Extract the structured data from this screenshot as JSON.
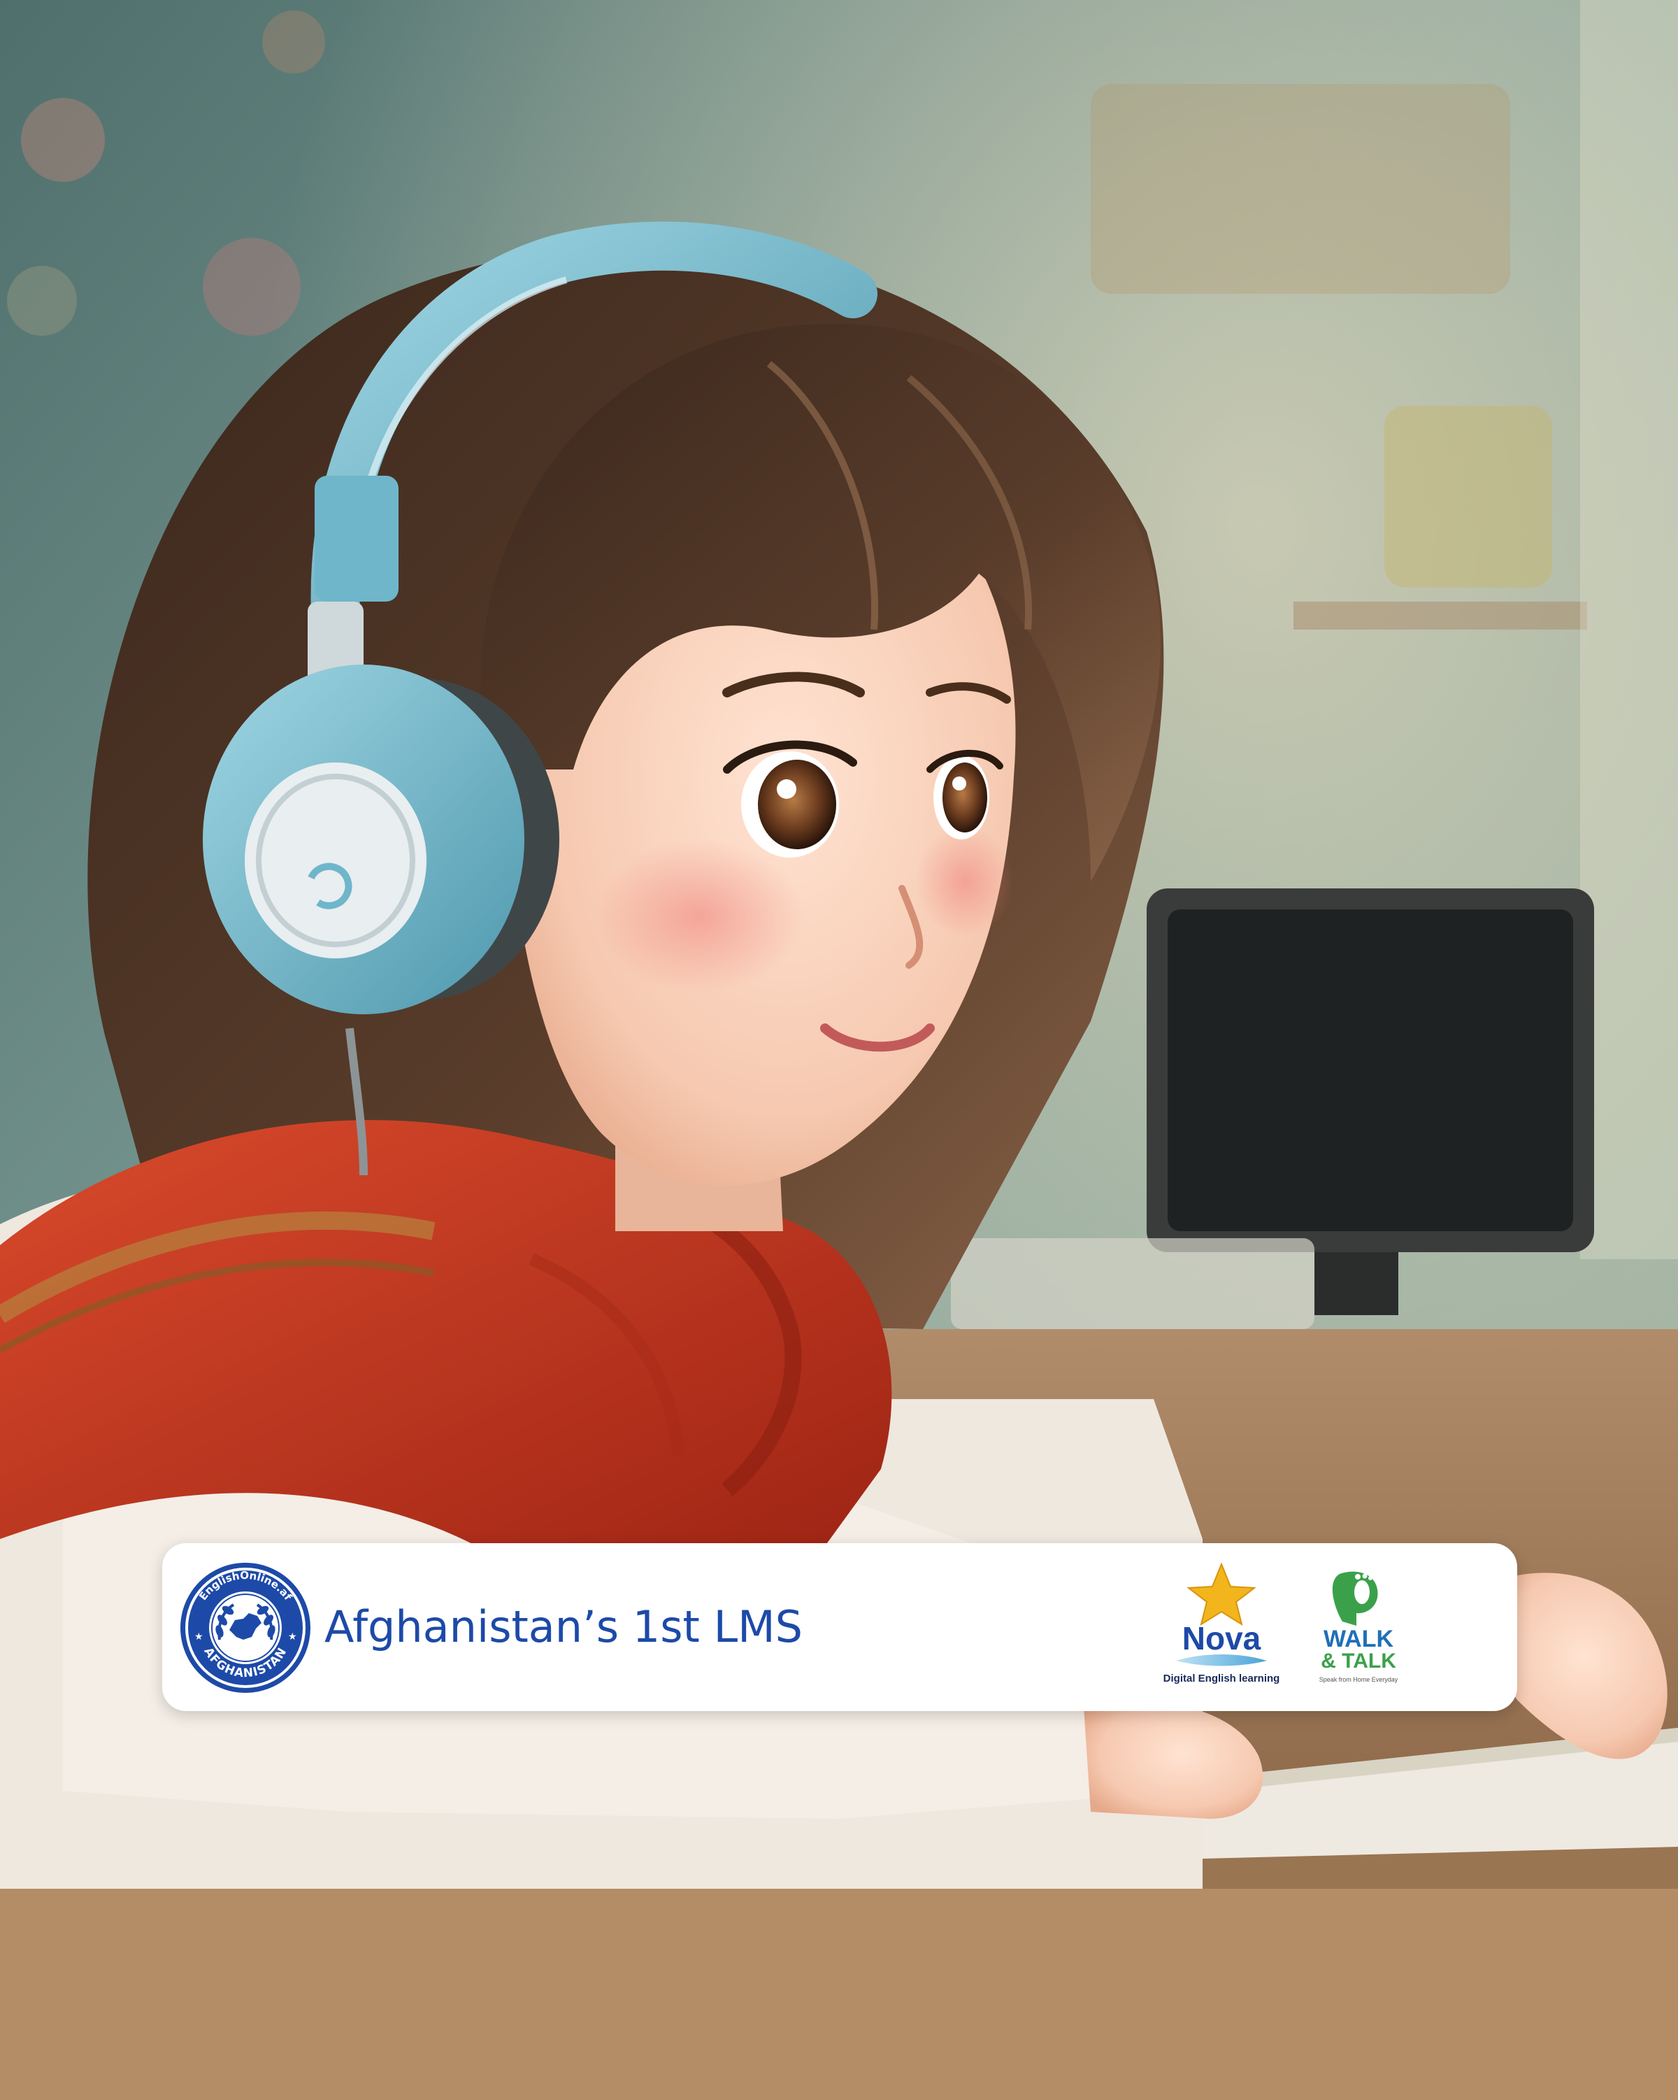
{
  "banner": {
    "title": "Afghanistan’s 1st LMS"
  },
  "logos": {
    "main_seal": {
      "ring_text_top": "EnglishOnline.af",
      "ring_text_bottom": "AFGHANISTAN"
    },
    "nova": {
      "name": "Nova",
      "tagline": "Digital English learning"
    },
    "walk_and_talk": {
      "name_line1": "WALK",
      "name_line2": "& TALK",
      "tagline": "Speak from Home Everyday"
    }
  },
  "colors": {
    "brand_blue": "#1d4aa8",
    "scarf_red": "#c8361f",
    "headphone_blue": "#7cc3d6",
    "nova_star": "#f2b51c",
    "walk_green": "#3aa14a",
    "walk_blue": "#1f6fb8"
  }
}
